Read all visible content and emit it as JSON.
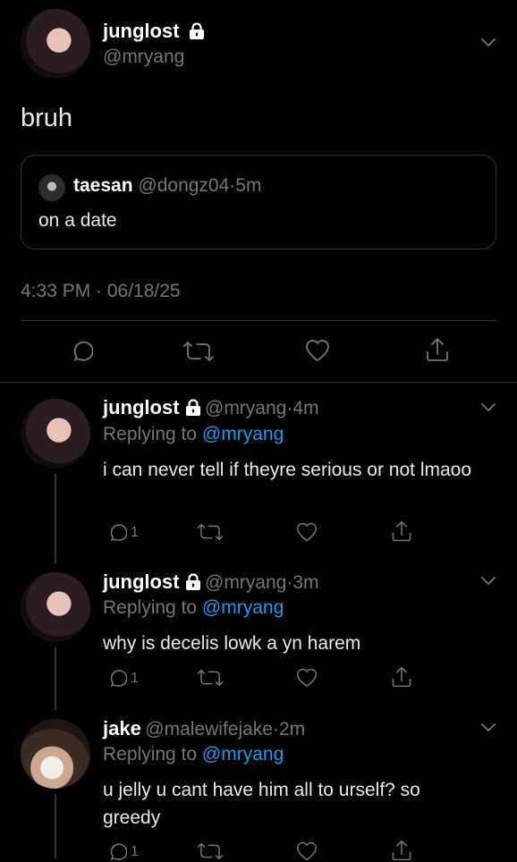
{
  "main_tweet": {
    "name": "junglost",
    "handle": "@mryang",
    "text": "bruh",
    "quote": {
      "name": "taesan",
      "handle": "@dongz04",
      "time": "5m",
      "text": "on a date"
    },
    "timestamp": "4:33 PM · 06/18/25"
  },
  "replies": [
    {
      "name": "junglost",
      "handle": "@mryang",
      "time": "4m",
      "replying_label": "Replying to",
      "replying_to": "@mryang",
      "text": "i can never tell if theyre serious or not lmaoo",
      "reply_count": "1"
    },
    {
      "name": "junglost",
      "handle": "@mryang",
      "time": "3m",
      "replying_label": "Replying to",
      "replying_to": "@mryang",
      "text": "why is decelis lowk a yn harem",
      "reply_count": "1"
    },
    {
      "name": "jake",
      "handle": "@malewifejake",
      "time": "2m",
      "replying_label": "Replying to",
      "replying_to": "@mryang",
      "text": "u jelly u cant have him all to urself? so greedy",
      "reply_count": "1"
    }
  ],
  "separator": "·",
  "icons": [
    "chevron-down-icon",
    "lock-icon",
    "reply-icon",
    "retweet-icon",
    "like-icon",
    "share-icon"
  ],
  "colors": {
    "background": "#000000",
    "text": "#e7e9ea",
    "muted": "#71767b",
    "link": "#1d9bf0",
    "divider": "#2f3336"
  }
}
